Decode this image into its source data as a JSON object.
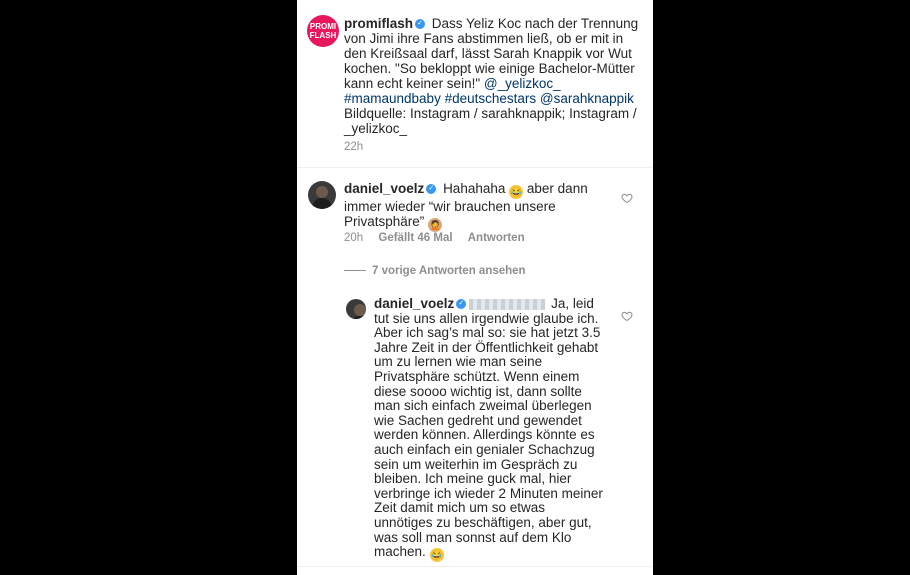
{
  "post": {
    "username": "promiflash",
    "avatar_text": "PROMI FLASH",
    "caption_text": "Dass Yeliz Koc nach der Trennung von Jimi ihre Fans abstimmen ließ, ob er mit in den Kreißsaal darf, lässt Sarah Knappik vor Wut kochen. \"So bekloppt wie einige Bachelor-Mütter kann echt keiner sein!\"",
    "mention1": "@_yelizkoc_",
    "hashtags": "#mamaundbaby #deutschestars",
    "mention2": "@sarahknappik",
    "source": "Bildquelle: Instagram / sarahknappik; Instagram / _yelizkoc_",
    "time": "22h"
  },
  "comment": {
    "username": "daniel_voelz",
    "text": "Hahahaha",
    "text2": "aber dann immer wieder “wir brauchen unsere Privatsphäre”",
    "time": "20h",
    "likes": "Gefällt 46 Mal",
    "reply_label": "Antworten"
  },
  "view_replies": "7 vorige Antworten ansehen",
  "reply": {
    "username": "daniel_voelz",
    "text": "Ja, leid tut sie uns allen irgendwie glaube ich. Aber ich sag’s mal so: sie hat jetzt 3.5 Jahre Zeit in der Öffentlichkeit gehabt um zu lernen wie man seine Privatsphäre schützt. Wenn einem diese soooo wichtig ist, dann sollte man sich einfach zweimal überlegen wie Sachen gedreht und gewendet werden können. Allerdings könnte es auch einfach ein genialer Schachzug sein um weiterhin im Gespräch zu bleiben. Ich meine guck mal, hier verbringe ich wieder 2 Minuten meiner Zeit damit mich um so etwas unnötiges zu beschäftigen, aber gut, was soll man sonnst auf dem Klo machen."
  },
  "icons": {
    "verified": "verified-badge-icon",
    "heart": "heart-outline-icon",
    "laugh_emoji": "face-with-tears-of-joy-emoji",
    "facepalm_emoji": "man-facepalming-emoji"
  },
  "colors": {
    "brand_promiflash": "#e8175d",
    "verified": "#3897f0",
    "link": "#00376b",
    "meta": "#8e8e8e"
  }
}
